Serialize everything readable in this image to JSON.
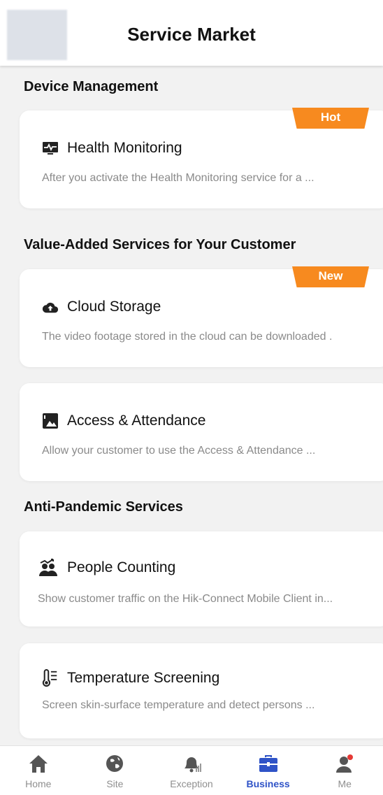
{
  "header": {
    "title": "Service Market"
  },
  "sections": [
    {
      "title": "Device Management"
    },
    {
      "title": "Value-Added Services for Your Customer"
    },
    {
      "title": "Anti-Pandemic Services"
    }
  ],
  "cards": [
    {
      "name": "Health Monitoring",
      "icon": "monitor-pulse-icon",
      "badge": "Hot",
      "desc": "After you activate the Health Monitoring service for a ..."
    },
    {
      "name": "Cloud Storage",
      "icon": "cloud-upload-icon",
      "badge": "New",
      "desc": "The video footage stored in the cloud can be downloaded ."
    },
    {
      "name": "Access & Attendance",
      "icon": "access-attendance-icon",
      "desc": "Allow your customer to use the Access & Attendance ..."
    },
    {
      "name": "People Counting",
      "icon": "people-counting-icon",
      "desc": "Show customer traffic on the Hik-Connect Mobile Client in..."
    },
    {
      "name": "Temperature Screening",
      "icon": "thermometer-icon",
      "desc": "Screen skin-surface temperature and detect persons ..."
    }
  ],
  "colors": {
    "badge": "#f78a1f",
    "active_tab": "#2f53c7",
    "inactive_tab": "#8f8f8f"
  },
  "tabs": [
    {
      "label": "Home",
      "icon": "home-icon"
    },
    {
      "label": "Site",
      "icon": "globe-icon"
    },
    {
      "label": "Exception",
      "icon": "bell-icon"
    },
    {
      "label": "Business",
      "icon": "briefcase-icon",
      "active": true
    },
    {
      "label": "Me",
      "icon": "user-icon"
    }
  ]
}
